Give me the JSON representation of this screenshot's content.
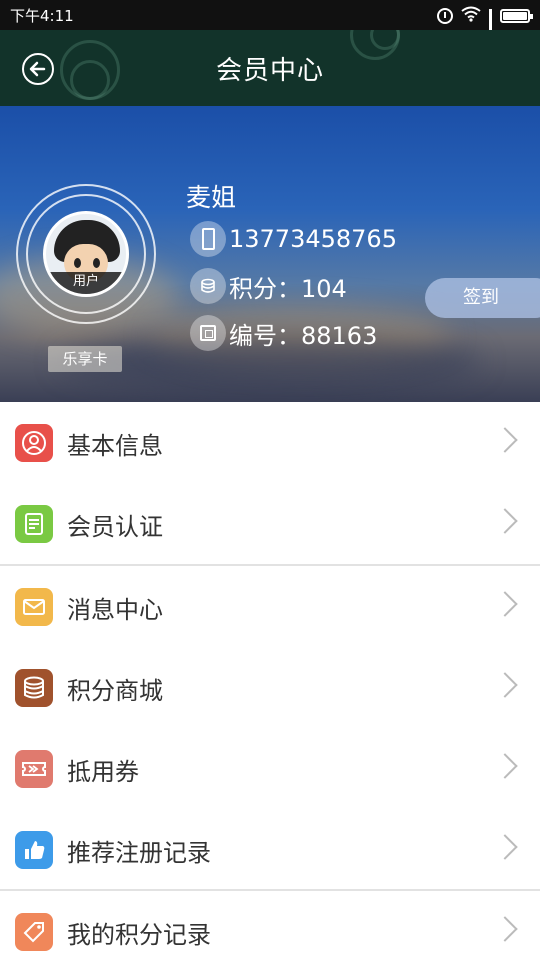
{
  "status_bar": {
    "time": "下午4:11"
  },
  "header": {
    "title": "会员中心"
  },
  "profile": {
    "avatar_caption": "用户",
    "card_label": "乐享卡",
    "name": "麦姐",
    "phone": "13773458765",
    "points": "积分：104",
    "number": "编号：88163",
    "signin_label": "签到"
  },
  "menu": {
    "items": [
      {
        "label": "基本信息",
        "icon": "user-icon",
        "color": "#e8504a"
      },
      {
        "label": "会员认证",
        "icon": "certificate-icon",
        "color": "#7ac943"
      },
      {
        "label": "消息中心",
        "icon": "envelope-icon",
        "color": "#f2b84b"
      },
      {
        "label": "积分商城",
        "icon": "coins-icon",
        "color": "#a0522d"
      },
      {
        "label": "抵用券",
        "icon": "ticket-icon",
        "color": "#e07a6e"
      },
      {
        "label": "推荐注册记录",
        "icon": "thumbs-up-icon",
        "color": "#3d9be9"
      },
      {
        "label": "我的积分记录",
        "icon": "tag-icon",
        "color": "#f0875a"
      }
    ]
  }
}
